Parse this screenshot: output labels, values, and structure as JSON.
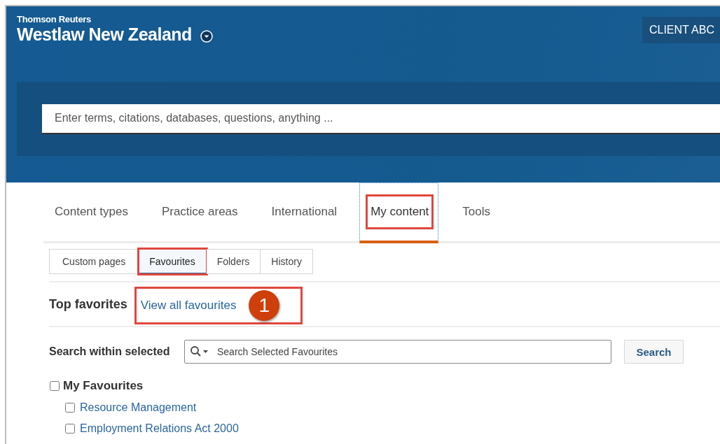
{
  "header": {
    "brand": "Thomson Reuters",
    "product": "Westlaw New Zealand",
    "client_button": "CLIENT ABC"
  },
  "search": {
    "placeholder": "Enter terms, citations, databases, questions, anything ..."
  },
  "main_tabs": [
    {
      "label": "Content types",
      "selected": false,
      "highlighted": false
    },
    {
      "label": "Practice areas",
      "selected": false,
      "highlighted": false
    },
    {
      "label": "International",
      "selected": false,
      "highlighted": false
    },
    {
      "label": "My content",
      "selected": true,
      "highlighted": true
    },
    {
      "label": "Tools",
      "selected": false,
      "highlighted": false
    }
  ],
  "sub_tabs": [
    {
      "label": "Custom pages",
      "selected": false,
      "highlighted": false
    },
    {
      "label": "Favourites",
      "selected": true,
      "highlighted": true
    },
    {
      "label": "Folders",
      "selected": false,
      "highlighted": false
    },
    {
      "label": "History",
      "selected": false,
      "highlighted": false
    }
  ],
  "favorites": {
    "title": "Top favorites",
    "link": "View all favourites",
    "link_highlighted": true,
    "callout": "1"
  },
  "search_within": {
    "label": "Search within selected",
    "placeholder": "Search Selected Favourites",
    "button": "Search"
  },
  "tree": [
    {
      "label": "My Favourites",
      "checked": false,
      "children": [
        {
          "label": "Resource Management",
          "checked": false
        },
        {
          "label": "Employment Relations Act 2000",
          "checked": false
        }
      ]
    }
  ]
}
